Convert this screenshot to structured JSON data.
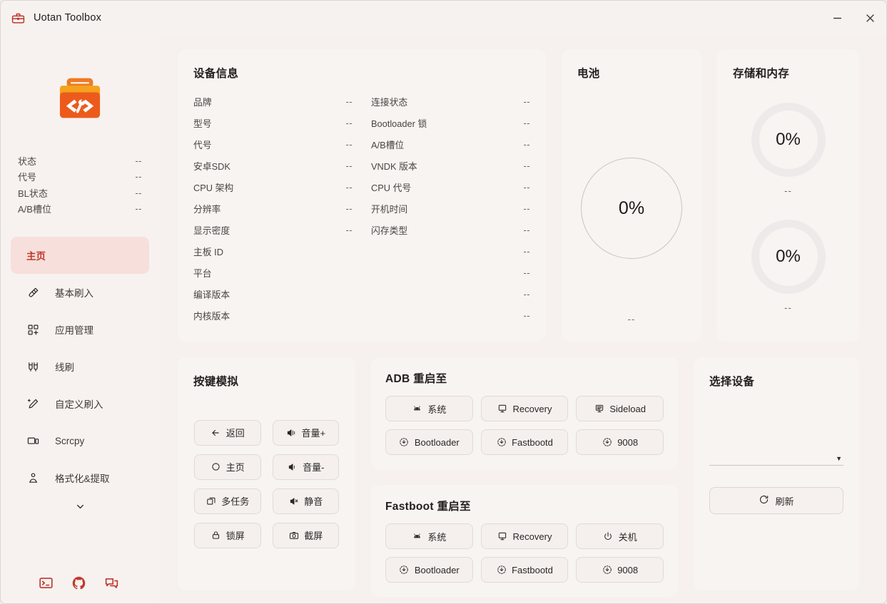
{
  "titlebar": {
    "app_icon": "toolbox-icon",
    "title": "Uotan Toolbox",
    "minimize": "–",
    "close": "✕"
  },
  "sidebar": {
    "logo": "toolbox-code-logo",
    "status": [
      {
        "label": "状态",
        "value": "--"
      },
      {
        "label": "代号",
        "value": "--"
      },
      {
        "label": "BL状态",
        "value": "--"
      },
      {
        "label": "A/B槽位",
        "value": "--"
      }
    ],
    "items": [
      {
        "label": "主页",
        "icon": "none",
        "active": true
      },
      {
        "label": "基本刷入",
        "icon": "flash-icon",
        "active": false
      },
      {
        "label": "应用管理",
        "icon": "apps-add-icon",
        "active": false
      },
      {
        "label": "线刷",
        "icon": "wire-flash-icon",
        "active": false
      },
      {
        "label": "自定义刷入",
        "icon": "pencil-sparkle-icon",
        "active": false
      },
      {
        "label": "Scrcpy",
        "icon": "screen-mirror-icon",
        "active": false
      },
      {
        "label": "格式化&提取",
        "icon": "person-extract-icon",
        "active": false
      }
    ],
    "expand_icon": "chevron-down-icon",
    "footer_icons": [
      "terminal-icon",
      "github-icon",
      "chat-icon"
    ],
    "accent": "#c0392b",
    "active_bg": "#f7dfdc"
  },
  "device_info": {
    "title": "设备信息",
    "left": [
      {
        "label": "品牌",
        "value": "--"
      },
      {
        "label": "型号",
        "value": "--"
      },
      {
        "label": "代号",
        "value": "--"
      },
      {
        "label": "安卓SDK",
        "value": "--"
      },
      {
        "label": "CPU 架构",
        "value": "--"
      },
      {
        "label": "分辨率",
        "value": "--"
      },
      {
        "label": "显示密度",
        "value": "--"
      }
    ],
    "right": [
      {
        "label": "连接状态",
        "value": "--"
      },
      {
        "label": "Bootloader 锁",
        "value": "--"
      },
      {
        "label": "A/B槽位",
        "value": "--"
      },
      {
        "label": "VNDK 版本",
        "value": "--"
      },
      {
        "label": "CPU 代号",
        "value": "--"
      },
      {
        "label": "开机时间",
        "value": "--"
      },
      {
        "label": "闪存类型",
        "value": "--"
      }
    ],
    "full": [
      {
        "label": "主板 ID",
        "value": "--"
      },
      {
        "label": "平台",
        "value": "--"
      },
      {
        "label": "编译版本",
        "value": "--"
      },
      {
        "label": "内核版本",
        "value": "--"
      }
    ]
  },
  "battery": {
    "title": "电池",
    "percent": "0%",
    "sub": "--"
  },
  "storage": {
    "title": "存储和内存",
    "units": [
      {
        "percent": "0%",
        "sub": "--"
      },
      {
        "percent": "0%",
        "sub": "--"
      }
    ]
  },
  "keys": {
    "title": "按键模拟",
    "buttons": [
      {
        "label": "返回",
        "icon": "arrow-left-icon"
      },
      {
        "label": "音量+",
        "icon": "volume-up-icon"
      },
      {
        "label": "主页",
        "icon": "circle-icon"
      },
      {
        "label": "音量-",
        "icon": "volume-down-icon"
      },
      {
        "label": "多任务",
        "icon": "multitask-icon"
      },
      {
        "label": "静音",
        "icon": "volume-mute-icon"
      },
      {
        "label": "锁屏",
        "icon": "lock-icon"
      },
      {
        "label": "截屏",
        "icon": "camera-icon"
      }
    ]
  },
  "adb_reboot": {
    "title": "ADB 重启至",
    "buttons": [
      {
        "label": "系统",
        "icon": "android-icon"
      },
      {
        "label": "Recovery",
        "icon": "recovery-icon"
      },
      {
        "label": "Sideload",
        "icon": "sideload-icon"
      },
      {
        "label": "Bootloader",
        "icon": "download-circle-icon"
      },
      {
        "label": "Fastbootd",
        "icon": "download-circle-icon"
      },
      {
        "label": "9008",
        "icon": "download-circle-icon"
      }
    ]
  },
  "fastboot_reboot": {
    "title": "Fastboot 重启至",
    "buttons": [
      {
        "label": "系统",
        "icon": "android-icon"
      },
      {
        "label": "Recovery",
        "icon": "recovery-icon"
      },
      {
        "label": "关机",
        "icon": "power-icon"
      },
      {
        "label": "Bootloader",
        "icon": "download-circle-icon"
      },
      {
        "label": "Fastbootd",
        "icon": "download-circle-icon"
      },
      {
        "label": "9008",
        "icon": "download-circle-icon"
      }
    ]
  },
  "device_select": {
    "title": "选择设备",
    "selected": "",
    "caret_icon": "chevron-down-icon",
    "refresh_label": "刷新",
    "refresh_icon": "refresh-icon"
  }
}
